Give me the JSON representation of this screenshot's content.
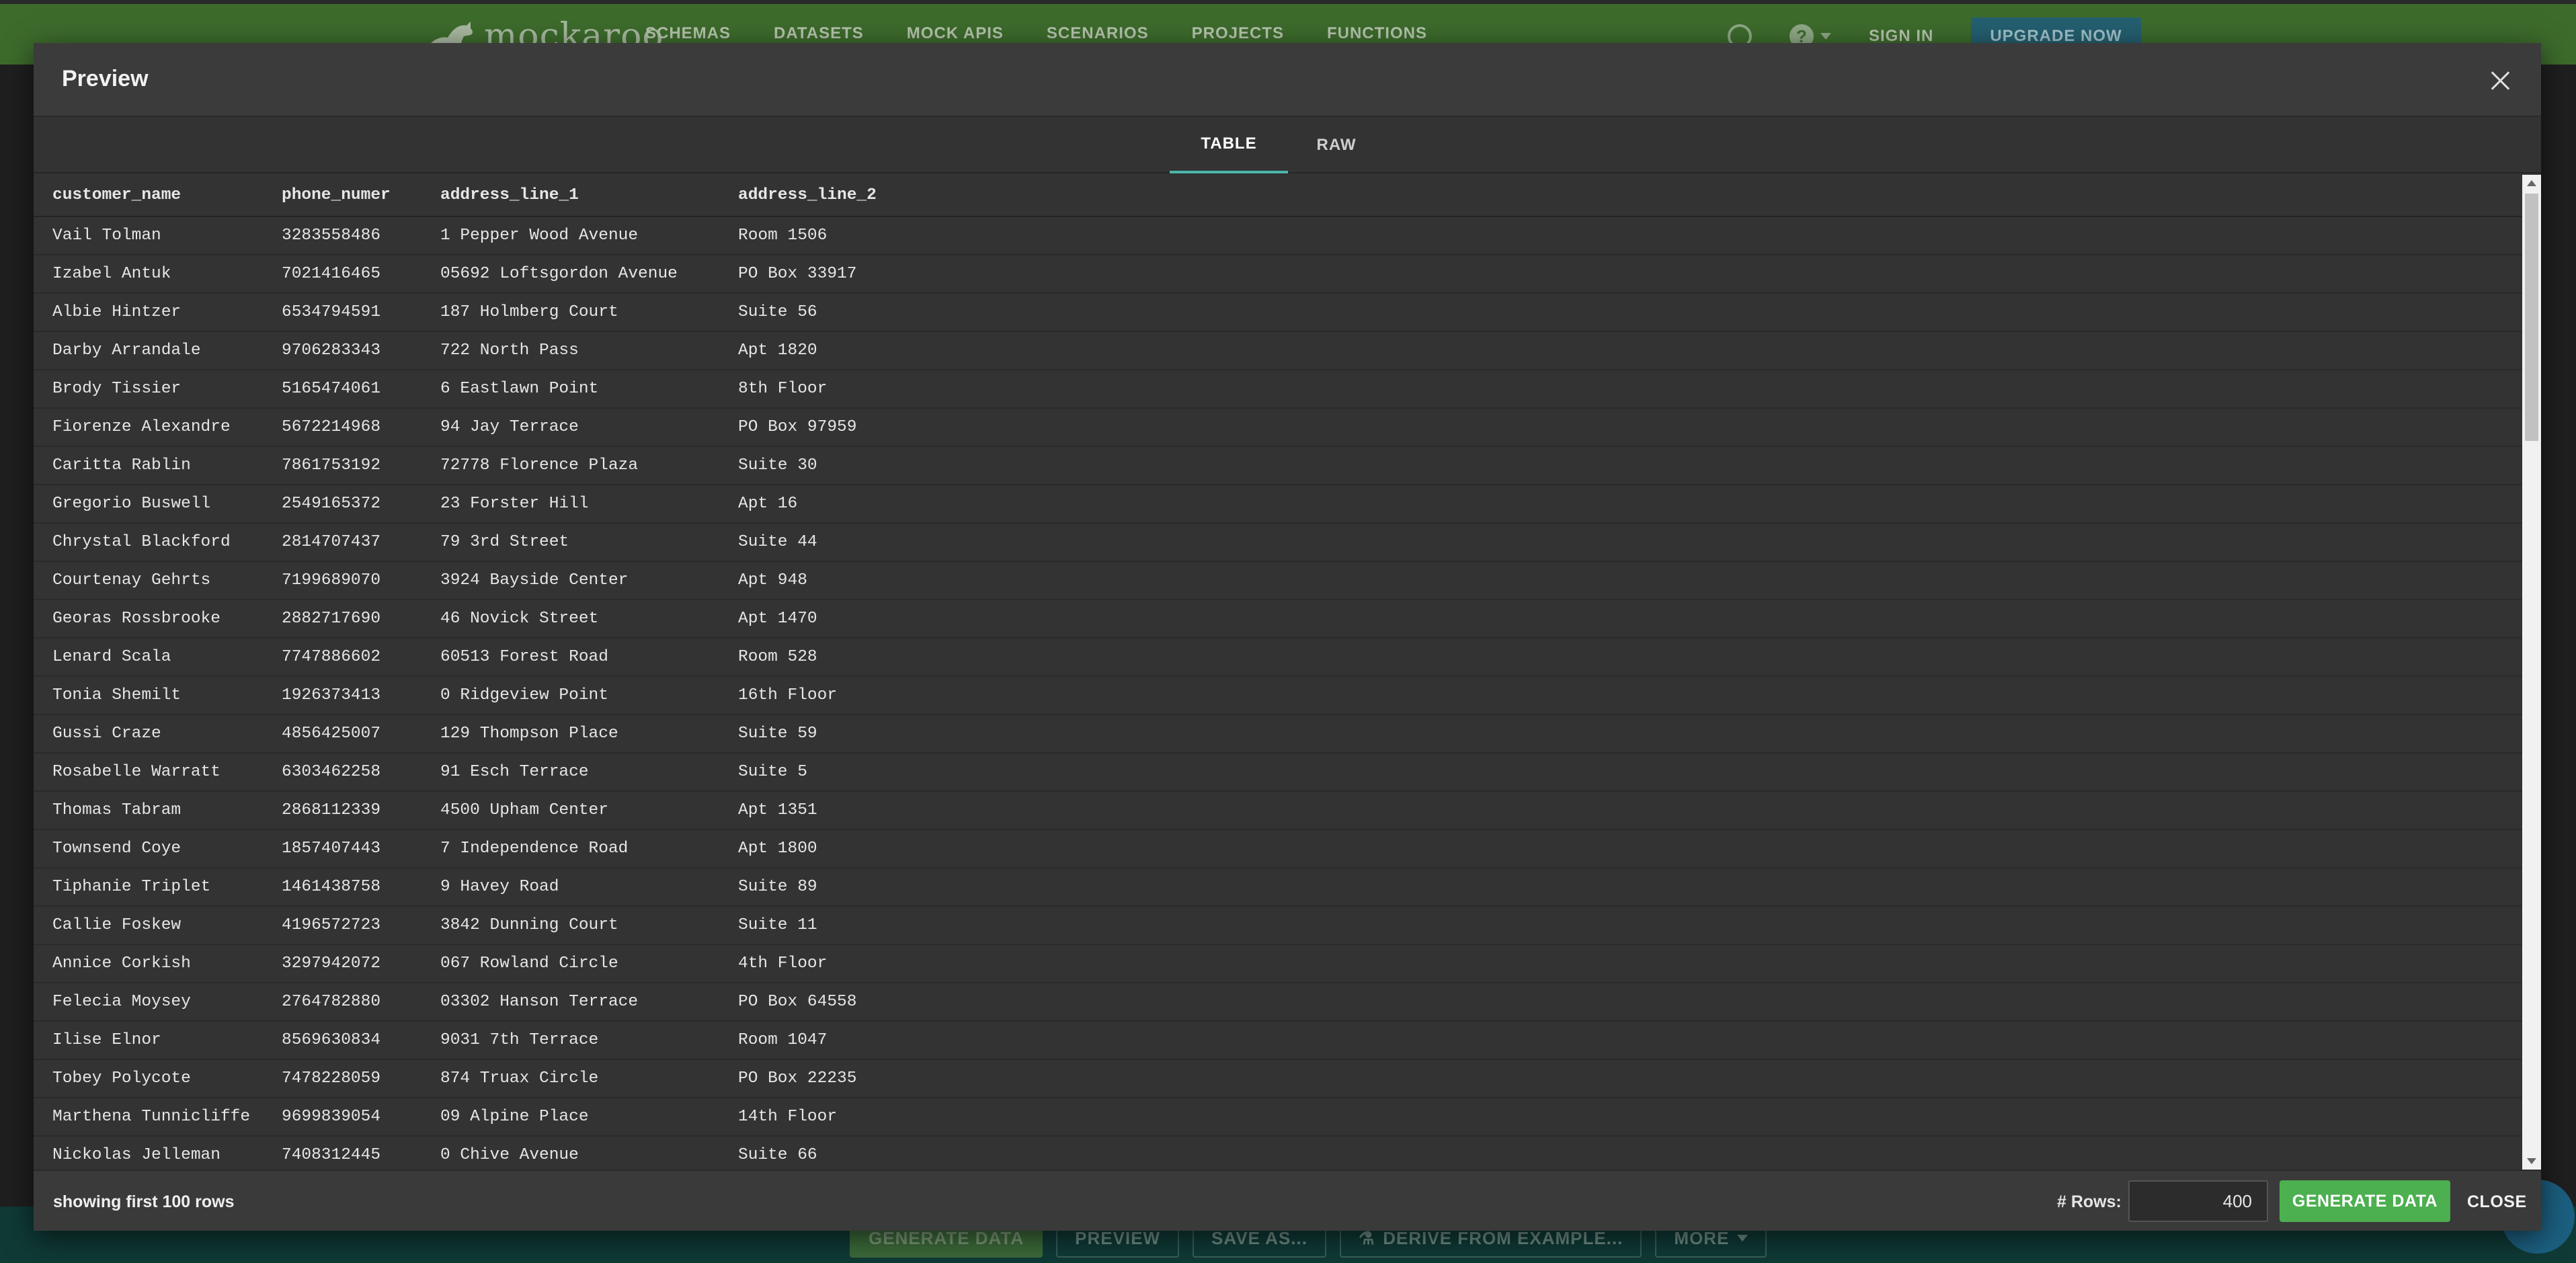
{
  "background": {
    "brand": "mockaroo",
    "nav": [
      "SCHEMAS",
      "DATASETS",
      "MOCK APIS",
      "SCENARIOS",
      "PROJECTS",
      "FUNCTIONS"
    ],
    "sign_in": "SIGN IN",
    "upgrade": "UPGRADE NOW",
    "toolbar": {
      "generate": "GENERATE DATA",
      "preview": "PREVIEW",
      "save_as": "SAVE AS...",
      "derive": "DERIVE FROM EXAMPLE...",
      "more": "MORE"
    }
  },
  "modal": {
    "title": "Preview",
    "tabs": [
      "TABLE",
      "RAW"
    ],
    "active_tab": "TABLE",
    "columns": [
      "customer_name",
      "phone_numer",
      "address_line_1",
      "address_line_2"
    ],
    "rows": [
      [
        "Vail Tolman",
        "3283558486",
        "1 Pepper Wood Avenue",
        "Room 1506"
      ],
      [
        "Izabel Antuk",
        "7021416465",
        "05692 Loftsgordon Avenue",
        "PO Box 33917"
      ],
      [
        "Albie Hintzer",
        "6534794591",
        "187 Holmberg Court",
        "Suite 56"
      ],
      [
        "Darby Arrandale",
        "9706283343",
        "722 North Pass",
        "Apt 1820"
      ],
      [
        "Brody Tissier",
        "5165474061",
        "6 Eastlawn Point",
        "8th Floor"
      ],
      [
        "Fiorenze Alexandre",
        "5672214968",
        "94 Jay Terrace",
        "PO Box 97959"
      ],
      [
        "Caritta Rablin",
        "7861753192",
        "72778 Florence Plaza",
        "Suite 30"
      ],
      [
        "Gregorio Buswell",
        "2549165372",
        "23 Forster Hill",
        "Apt 16"
      ],
      [
        "Chrystal Blackford",
        "2814707437",
        "79 3rd Street",
        "Suite 44"
      ],
      [
        "Courtenay Gehrts",
        "7199689070",
        "3924 Bayside Center",
        "Apt 948"
      ],
      [
        "Georas Rossbrooke",
        "2882717690",
        "46 Novick Street",
        "Apt 1470"
      ],
      [
        "Lenard Scala",
        "7747886602",
        "60513 Forest Road",
        "Room 528"
      ],
      [
        "Tonia Shemilt",
        "1926373413",
        "0 Ridgeview Point",
        "16th Floor"
      ],
      [
        "Gussi Craze",
        "4856425007",
        "129 Thompson Place",
        "Suite 59"
      ],
      [
        "Rosabelle Warratt",
        "6303462258",
        "91 Esch Terrace",
        "Suite 5"
      ],
      [
        "Thomas Tabram",
        "2868112339",
        "4500 Upham Center",
        "Apt 1351"
      ],
      [
        "Townsend Coye",
        "1857407443",
        "7 Independence Road",
        "Apt 1800"
      ],
      [
        "Tiphanie Triplet",
        "1461438758",
        "9 Havey Road",
        "Suite 89"
      ],
      [
        "Callie Foskew",
        "4196572723",
        "3842 Dunning Court",
        "Suite 11"
      ],
      [
        "Annice Corkish",
        "3297942072",
        "067 Rowland Circle",
        "4th Floor"
      ],
      [
        "Felecia Moysey",
        "2764782880",
        "03302 Hanson Terrace",
        "PO Box 64558"
      ],
      [
        "Ilise Elnor",
        "8569630834",
        "9031 7th Terrace",
        "Room 1047"
      ],
      [
        "Tobey Polycote",
        "7478228059",
        "874 Truax Circle",
        "PO Box 22235"
      ],
      [
        "Marthena Tunnicliffe",
        "9699839054",
        "09 Alpine Place",
        "14th Floor"
      ],
      [
        "Nickolas Jelleman",
        "7408312445",
        "0 Chive Avenue",
        "Suite 66"
      ]
    ],
    "footer": {
      "note": "showing first 100 rows",
      "rows_label": "# Rows:",
      "rows_value": "400",
      "generate": "GENERATE DATA",
      "close": "CLOSE"
    }
  },
  "colors": {
    "header_green": "#3d6b2c",
    "modal_bg": "#323232",
    "accent_teal": "#4db6ac",
    "generate_green": "#4caf50"
  }
}
